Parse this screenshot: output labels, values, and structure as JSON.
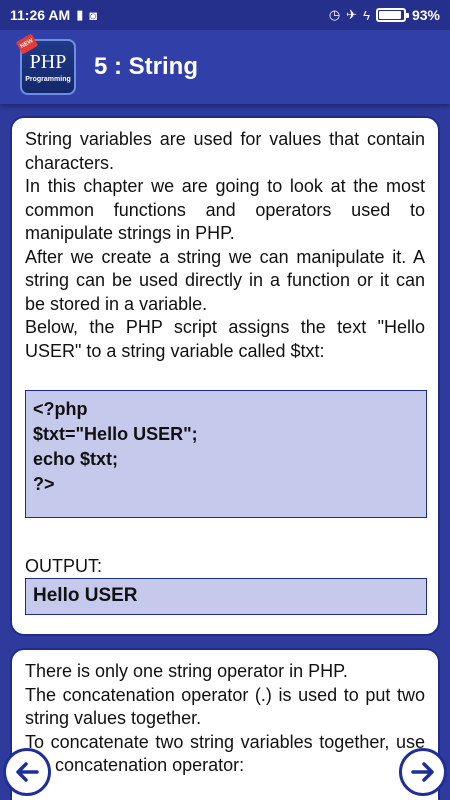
{
  "status_bar": {
    "time": "11:26 AM",
    "battery_percent": "93%",
    "battery_level": 0.93,
    "icons": [
      "sim-icon",
      "android-icon",
      "alarm-icon",
      "airplane-icon",
      "charging-icon",
      "battery-icon"
    ]
  },
  "app_bar": {
    "logo_text": "PHP",
    "logo_subtext": "Programming",
    "logo_badge": "NEW",
    "title": "5 : String"
  },
  "lesson": {
    "paragraphs": [
      "String variables are used for values that contain characters.",
      "In this chapter we are going to look at the most common functions and operators used to manipulate strings in PHP.",
      "After we create a string we can manipulate it. A string can be used directly in a function or it can be stored in a variable.",
      "Below, the PHP script assigns the text \"Hello USER\" to a string variable called $txt:"
    ],
    "code_lines": [
      "<?php",
      "$txt=\"Hello USER\";",
      "echo $txt;",
      "?>"
    ],
    "output_label": "OUTPUT:",
    "output_value": "Hello USER"
  },
  "lesson2": {
    "paragraphs": [
      "There is only one string operator in PHP.",
      "The concatenation operator (.) is used to put two string values together.",
      "To concatenate two string variables together, use the concatenation operator:"
    ]
  },
  "nav": {
    "prev_icon": "arrow-left-icon",
    "next_icon": "arrow-right-icon"
  },
  "colors": {
    "background": "#2e3a9c",
    "app_bar": "#3140a8",
    "code_box": "#c5c9ec",
    "border": "#1e2c8c"
  }
}
